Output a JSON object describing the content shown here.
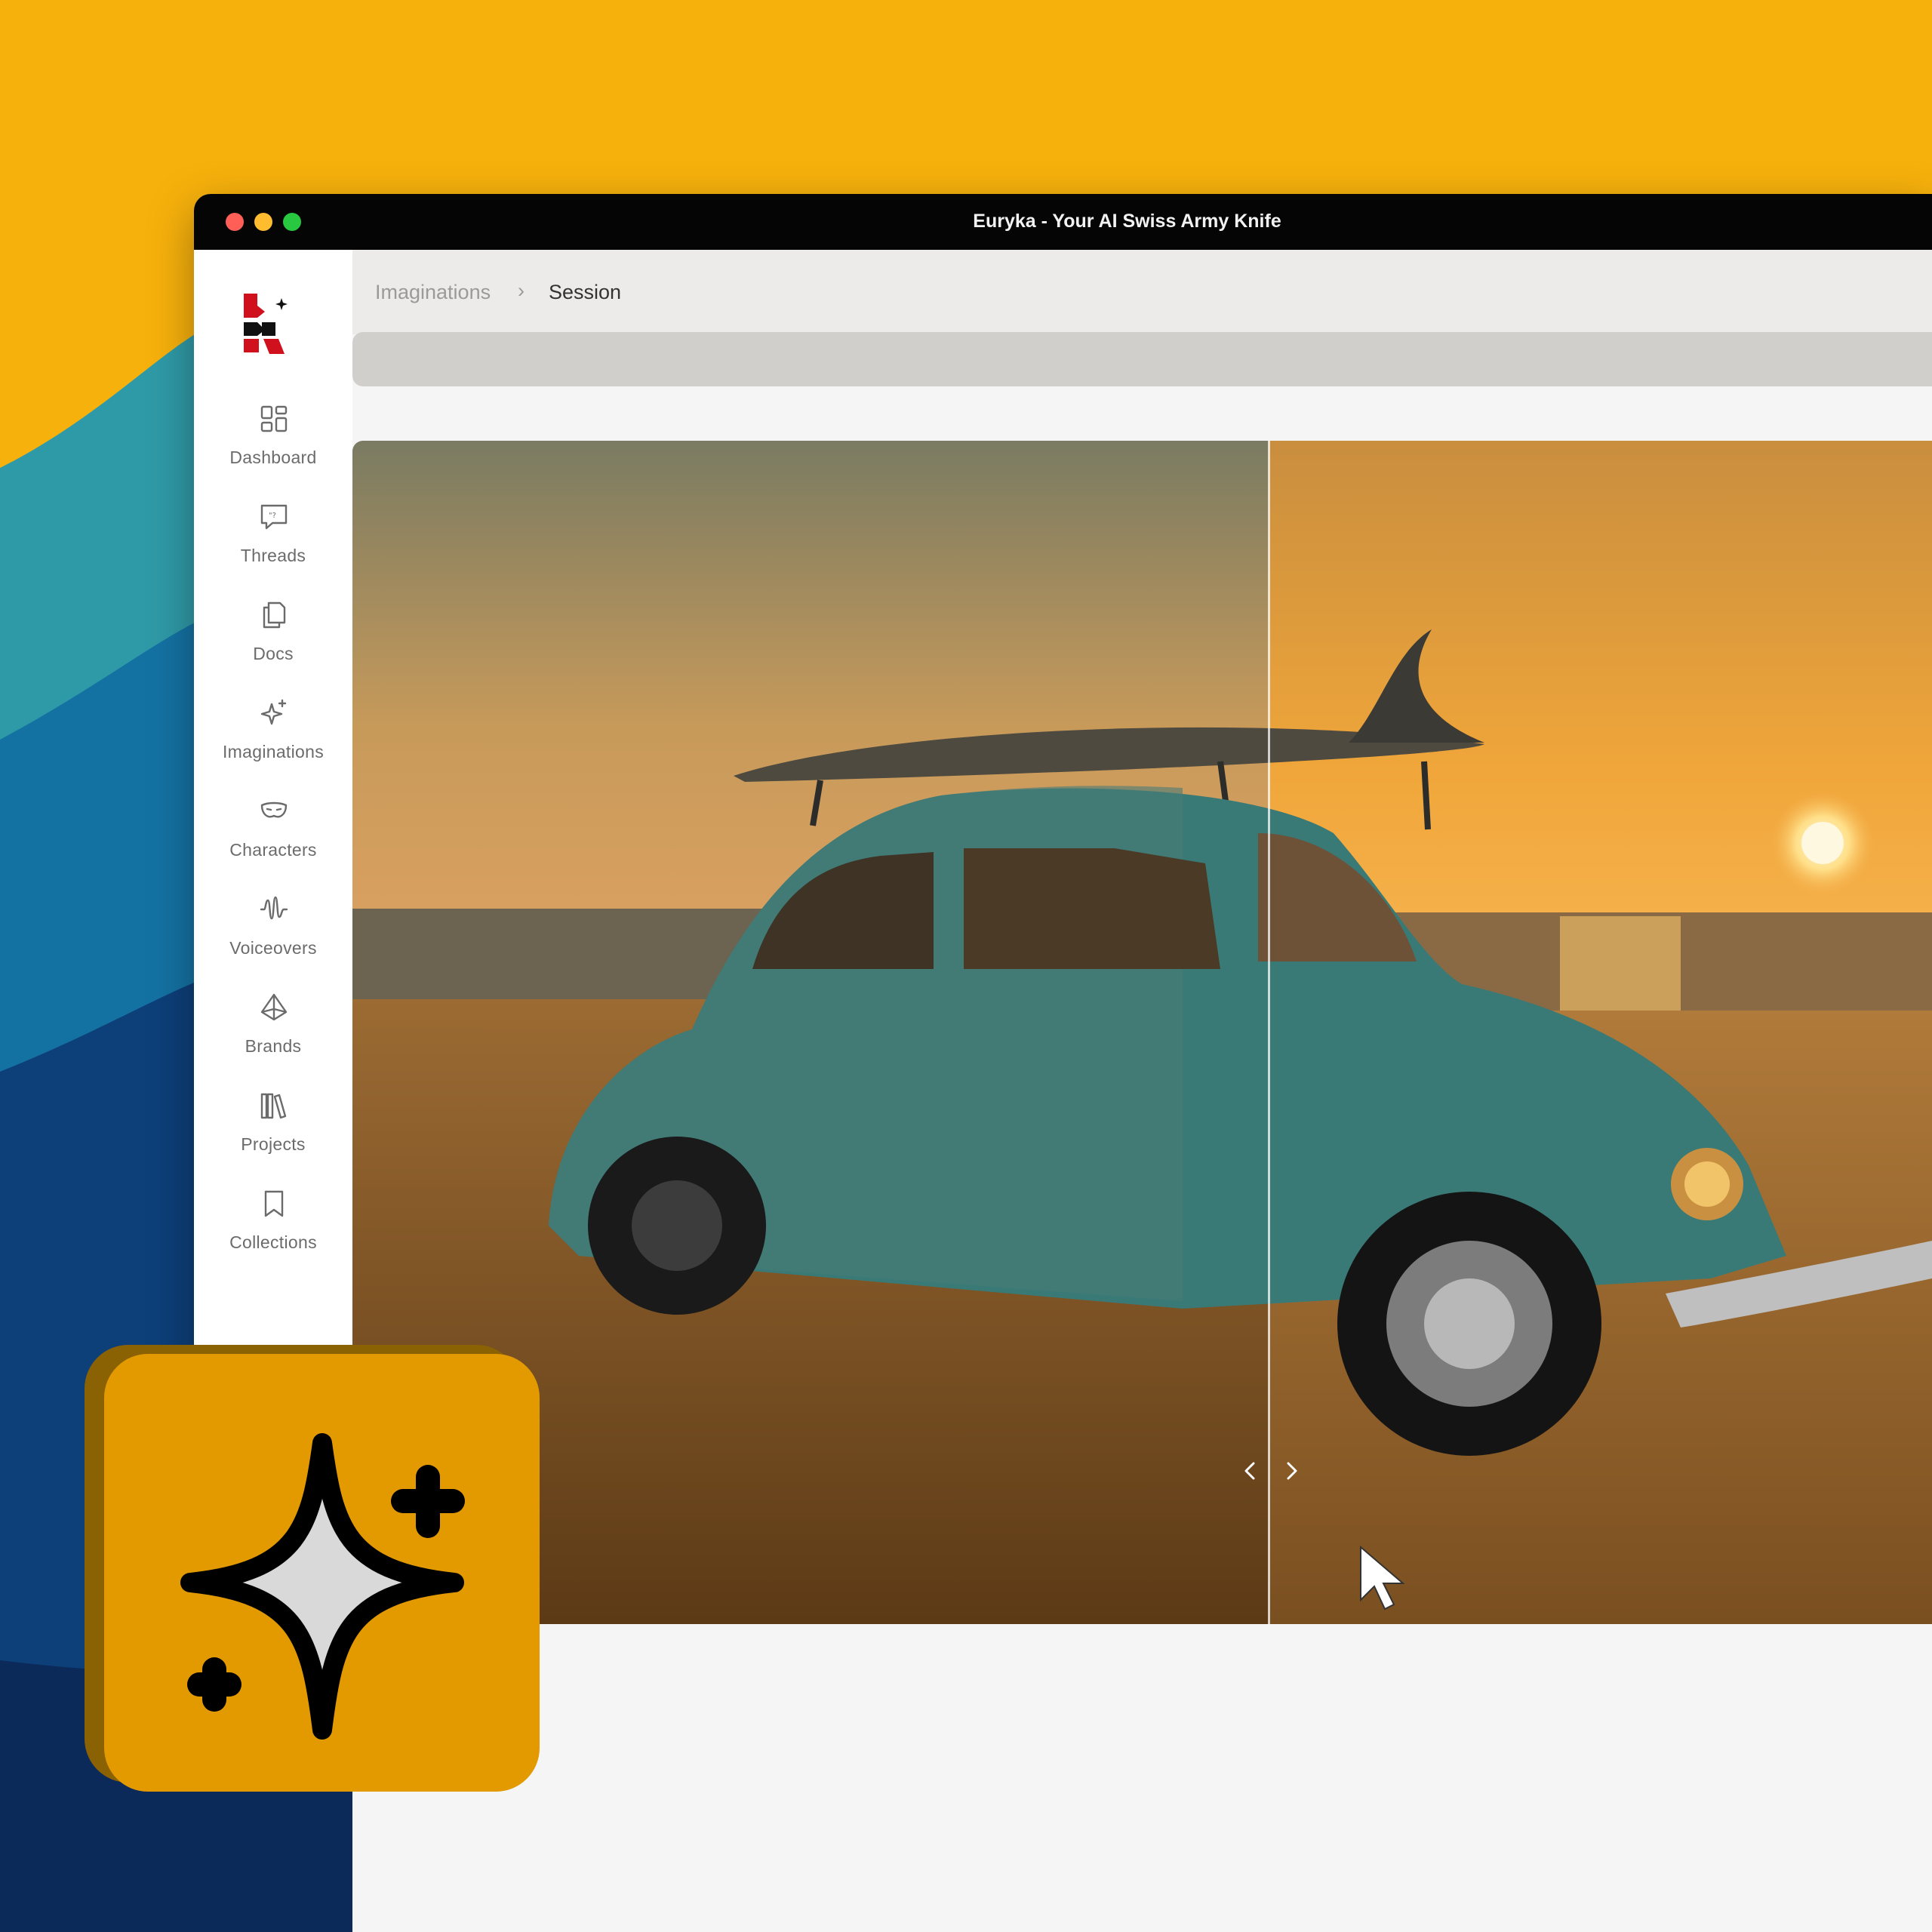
{
  "window": {
    "title": "Euryka - Your AI Swiss Army Knife"
  },
  "sidebar": {
    "items": [
      {
        "label": "Dashboard",
        "icon": "dashboard-icon"
      },
      {
        "label": "Threads",
        "icon": "threads-icon"
      },
      {
        "label": "Docs",
        "icon": "docs-icon"
      },
      {
        "label": "Imaginations",
        "icon": "sparkles-icon"
      },
      {
        "label": "Characters",
        "icon": "mask-icon"
      },
      {
        "label": "Voiceovers",
        "icon": "waveform-icon"
      },
      {
        "label": "Brands",
        "icon": "diamond-icon"
      },
      {
        "label": "Projects",
        "icon": "books-icon"
      },
      {
        "label": "Collections",
        "icon": "bookmark-icon"
      }
    ]
  },
  "breadcrumb": {
    "parent": "Imaginations",
    "separator": "›",
    "current": "Session"
  },
  "badge": {
    "icon": "sparkles-icon"
  }
}
